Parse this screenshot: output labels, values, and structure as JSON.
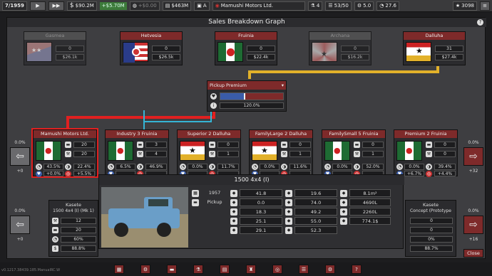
{
  "topbar": {
    "date": "7/1959",
    "money": "$90.2M",
    "income": "+$5.70M",
    "expense": "+$0.00",
    "loan": "$463M",
    "rating": "A",
    "company": "Mamushi Motors Ltd.",
    "research": "4",
    "staff": "53/50",
    "stat_a": "5.0",
    "stat_b": "27.6",
    "points": "3098"
  },
  "panel": {
    "title": "Sales Breakdown Graph",
    "help": "?"
  },
  "countries": [
    {
      "name": "Gasmea",
      "value": "0",
      "money": "$26.1k",
      "active": false
    },
    {
      "name": "Hetvesia",
      "value": "0",
      "money": "$26.5k",
      "active": true
    },
    {
      "name": "Fruinia",
      "value": "0",
      "money": "$22.4k",
      "active": true
    },
    {
      "name": "Archana",
      "value": "0",
      "money": "$16.2k",
      "active": false
    },
    {
      "name": "Dalluha",
      "value": "31",
      "money": "$27.4k",
      "active": true
    }
  ],
  "segment": {
    "name": "Pickup Premium",
    "percent": "120.0%"
  },
  "companies": [
    {
      "name": "Mamushi Motors Ltd.",
      "v1": "20",
      "v2": "20",
      "p1": "43.5%",
      "p2": "22.4%",
      "p3": "+0.0%",
      "p4": "+5.5%"
    },
    {
      "name": "Industry 3 Fruinia",
      "v1": "3",
      "v2": "4",
      "p1": "6.5%",
      "p2": "46.9%",
      "p3": "",
      "p4": ""
    },
    {
      "name": "Superior 2 Dalluha",
      "v1": "0",
      "v2": "1",
      "p1": "0.0%",
      "p2": "11.7%",
      "p3": "",
      "p4": ""
    },
    {
      "name": "FamilyLarge 2 Dalluha",
      "v1": "0",
      "v2": "1",
      "p1": "0.0%",
      "p2": "11.6%",
      "p3": "",
      "p4": ""
    },
    {
      "name": "FamilySmall 5 Fruinia",
      "v1": "0",
      "v2": "1",
      "p1": "0.0%",
      "p2": "52.0%",
      "p3": "",
      "p4": ""
    },
    {
      "name": "Premium 2 Fruinia",
      "v1": "0",
      "v2": "0",
      "p1": "0.0%",
      "p2": "39.4%",
      "p3": "+6.7%",
      "p4": "+4.4%"
    }
  ],
  "left_side": {
    "top_pct": "0.0%",
    "top_val": "+0",
    "bot_pct": "0.0%",
    "bot_val": "+0"
  },
  "right_side": {
    "top_pct": "0.0%",
    "top_val": "+32",
    "bot_pct": "0.0%",
    "bot_val": "+16"
  },
  "left_card": {
    "title": "Kasete",
    "model": "1500 4x4 (I) (Mk 1)",
    "r1": "12",
    "r2": "20",
    "r3": "60%",
    "r4": "88.8%"
  },
  "right_card": {
    "title": "Kasete",
    "model": "Concept (Prototype",
    "r1": "0",
    "r2": "0",
    "r3": "0%",
    "r4": "88.7%"
  },
  "popup": {
    "title": "1500 4x4 (I)",
    "year": "1957",
    "type": "Pickup",
    "col1": [
      "41.8",
      "0.0",
      "18.3",
      "25.1",
      "29.1"
    ],
    "col2": [
      "19.6",
      "74.0",
      "49.2",
      "55.0",
      "52.3"
    ],
    "col3": [
      "8.1m²",
      "4690L",
      "2260L",
      "774.1$"
    ],
    "col4": [
      "20.4",
      "-0.5"
    ]
  },
  "close_label": "Close",
  "version": "v0.1217.38439.185.ManualRC.W"
}
